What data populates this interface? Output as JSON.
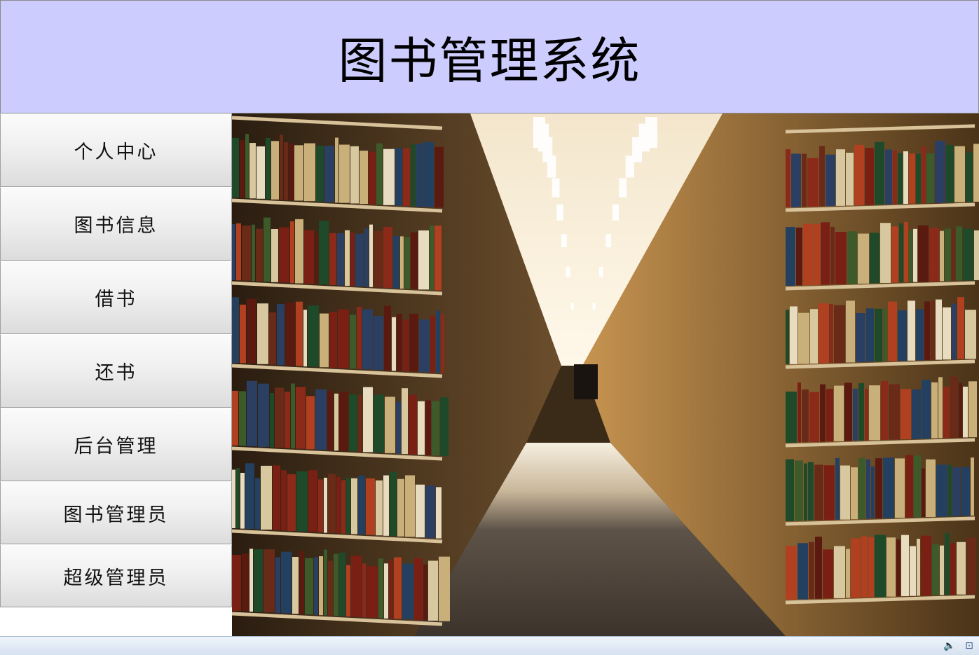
{
  "header": {
    "title": "图书管理系统"
  },
  "sidebar": {
    "items": [
      {
        "label": "个人中心"
      },
      {
        "label": "图书信息"
      },
      {
        "label": "借书"
      },
      {
        "label": "还书"
      },
      {
        "label": "后台管理"
      },
      {
        "label": "图书管理员"
      },
      {
        "label": "超级管理员"
      }
    ]
  },
  "main": {
    "image_icon": "library-bookshelves-image"
  },
  "statusbar": {
    "icons": [
      "speaker-icon",
      "network-icon"
    ]
  }
}
